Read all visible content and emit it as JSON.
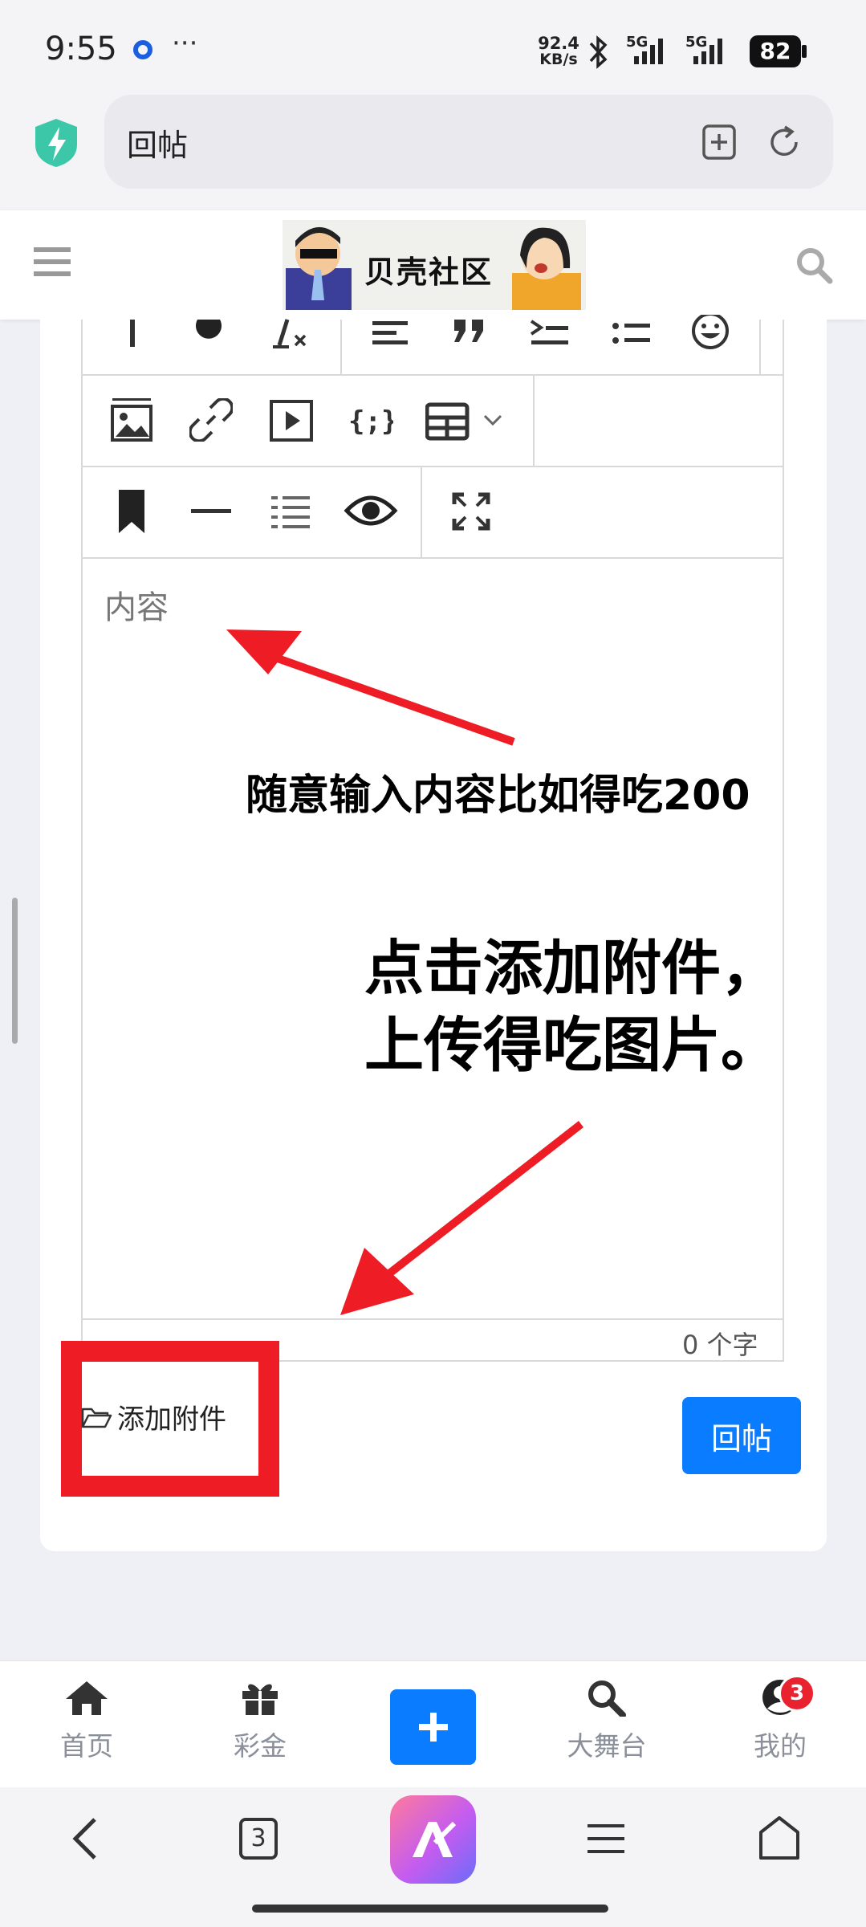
{
  "status": {
    "time": "9:55",
    "more": "···",
    "net_speed_top": "92.4",
    "net_speed_bottom": "KB/s",
    "sig1": "5G",
    "sig2": "5G",
    "battery": "82"
  },
  "browser": {
    "url_text": "回帖"
  },
  "site": {
    "logo_text": "贝壳社区"
  },
  "editor": {
    "placeholder": "内容",
    "char_count": "0 个字"
  },
  "actions": {
    "attach_label": "添加附件",
    "reply_label": "回帖"
  },
  "annotations": {
    "hint1": "随意输入内容比如得吃200",
    "hint2_line1": "点击添加附件，",
    "hint2_line2": "上传得吃图片。"
  },
  "bottom_nav": {
    "home": "首页",
    "prize": "彩金",
    "stage": "大舞台",
    "mine": "我的",
    "mine_badge": "3"
  },
  "system_nav": {
    "tabs_count": "3"
  },
  "colors": {
    "accent_blue": "#0a7cff",
    "annotation_red": "#ee1c25",
    "badge_red": "#e8222e"
  }
}
